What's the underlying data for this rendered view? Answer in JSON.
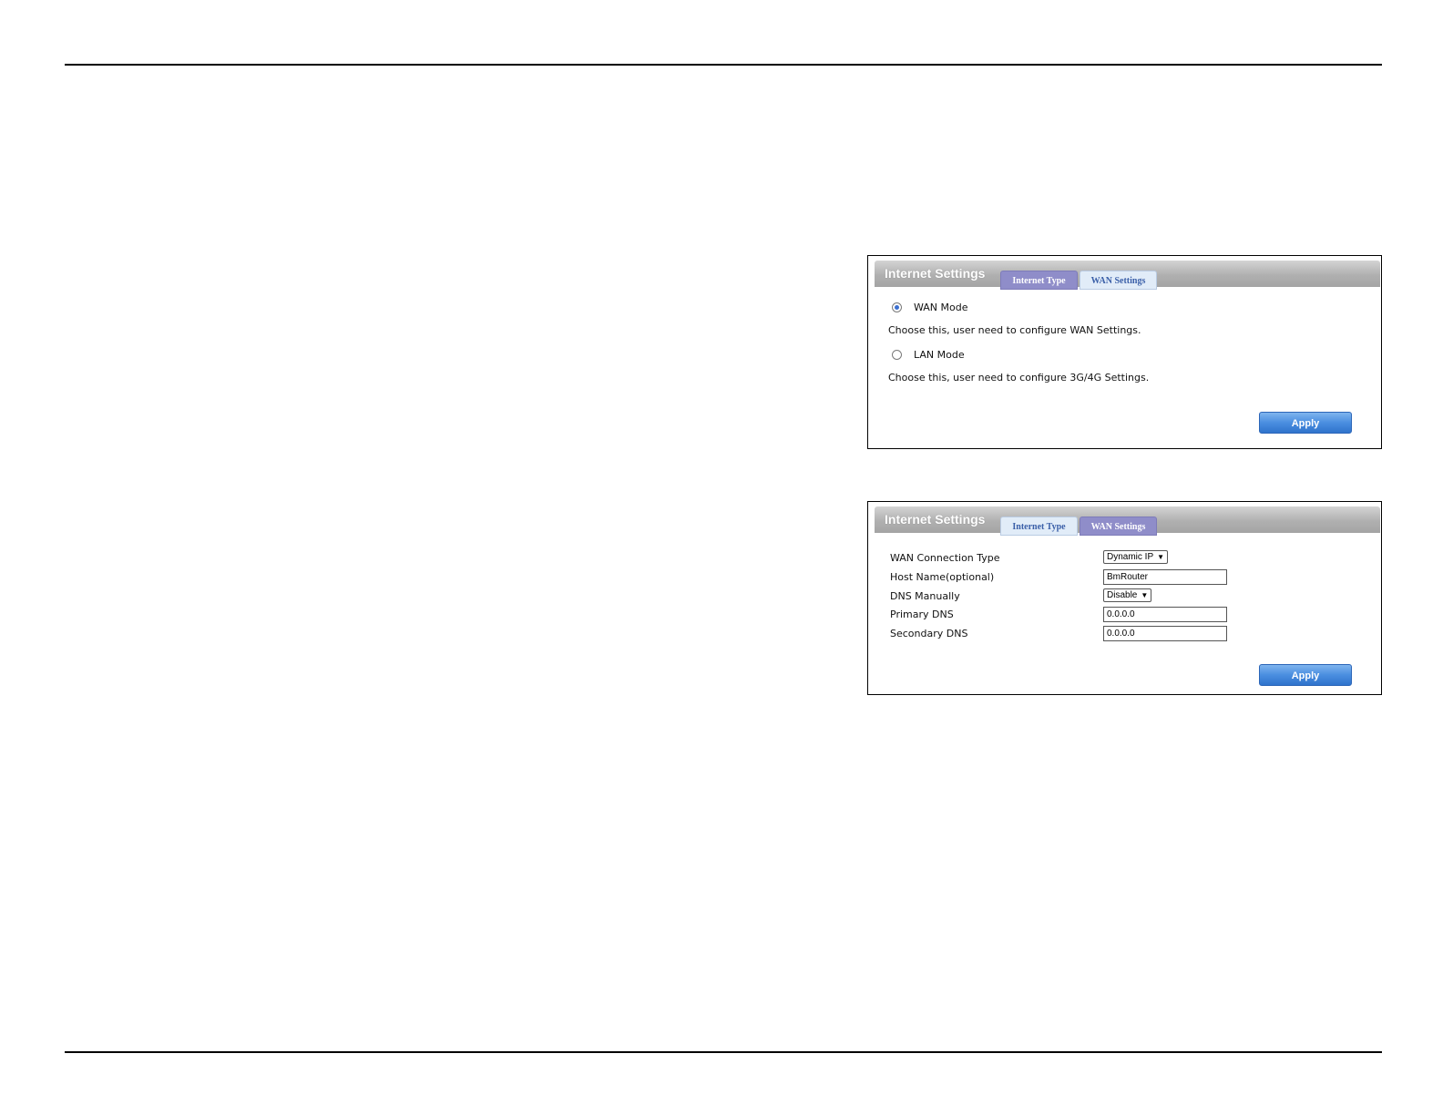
{
  "panel1": {
    "title": "Internet Settings",
    "tabs": [
      {
        "label": "Internet Type",
        "active": true
      },
      {
        "label": "WAN Settings",
        "active": false
      }
    ],
    "options": [
      {
        "label": "WAN Mode",
        "checked": true,
        "description": "Choose this, user need to configure WAN Settings."
      },
      {
        "label": "LAN Mode",
        "checked": false,
        "description": "Choose this, user need to configure 3G/4G Settings."
      }
    ],
    "apply_label": "Apply"
  },
  "panel2": {
    "title": "Internet Settings",
    "tabs": [
      {
        "label": "Internet Type",
        "active": false
      },
      {
        "label": "WAN Settings",
        "active": true
      }
    ],
    "fields": {
      "wan_connection_type": {
        "label": "WAN Connection Type",
        "value": "Dynamic IP"
      },
      "host_name": {
        "label": "Host Name(optional)",
        "value": "BmRouter"
      },
      "dns_manually": {
        "label": "DNS Manually",
        "value": "Disable"
      },
      "primary_dns": {
        "label": "Primary DNS",
        "value": "0.0.0.0"
      },
      "secondary_dns": {
        "label": "Secondary DNS",
        "value": "0.0.0.0"
      }
    },
    "apply_label": "Apply"
  },
  "colors": {
    "active_tab": "#8f8dc9",
    "inactive_tab": "#e1ecf8",
    "apply_button": "#4a8ee0",
    "radio_selected": "#3b6fd0"
  },
  "icons": [
    "radio-selected-icon",
    "radio-unselected-icon",
    "chevron-down-icon"
  ]
}
